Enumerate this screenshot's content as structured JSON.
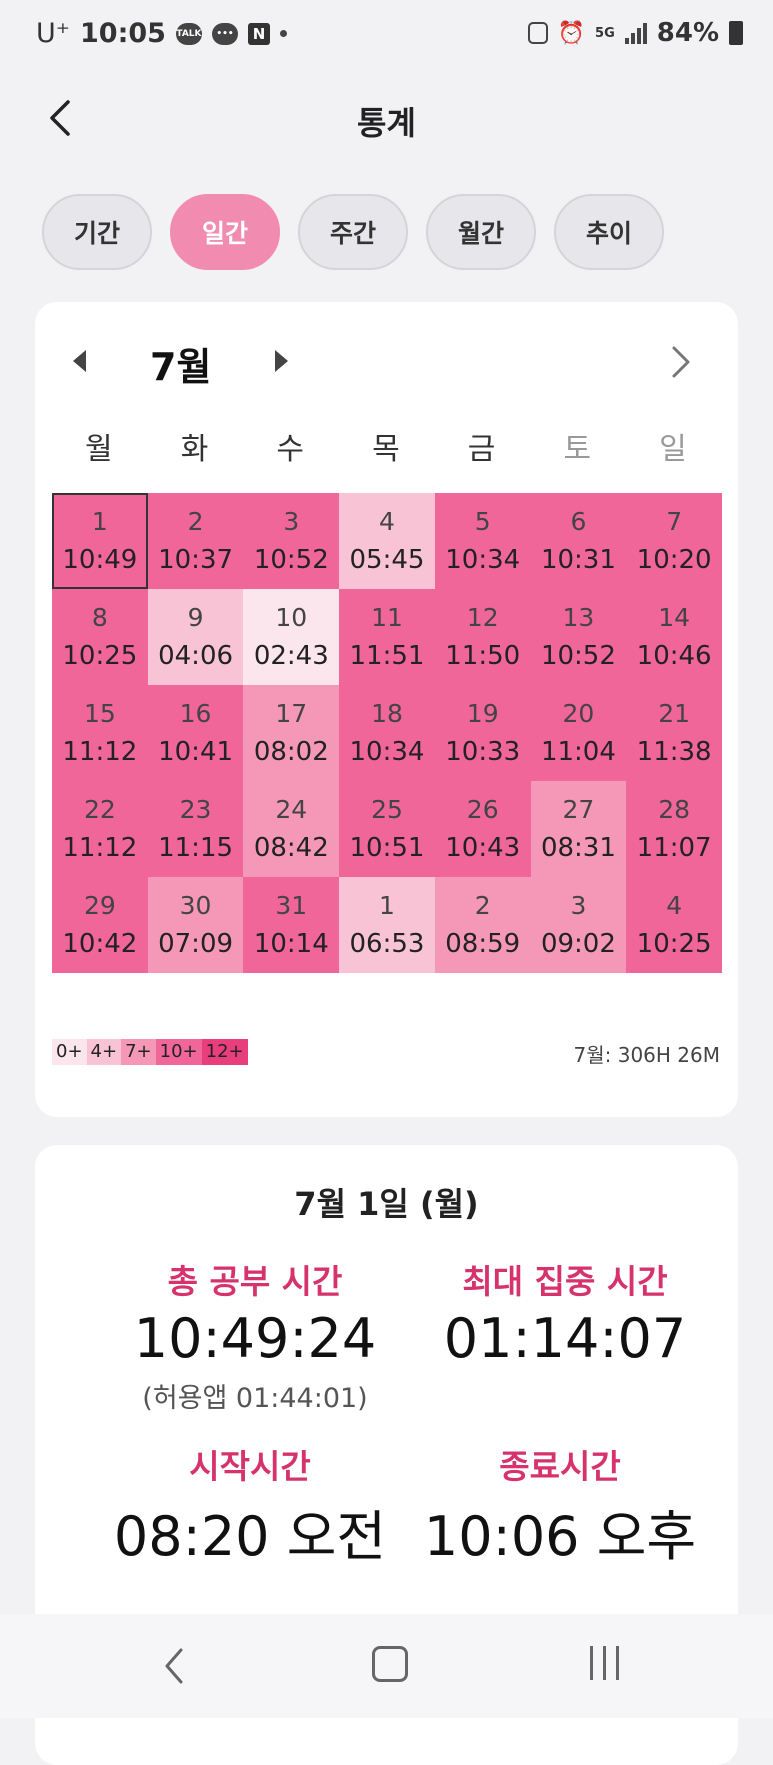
{
  "status_bar": {
    "carrier": "U⁺",
    "time": "10:05",
    "talk_badge": "TALK",
    "n_badge": "N",
    "network": "5G",
    "battery": "84%"
  },
  "header": {
    "title": "통계"
  },
  "tabs": [
    {
      "label": "기간",
      "active": false
    },
    {
      "label": "일간",
      "active": true
    },
    {
      "label": "주간",
      "active": false
    },
    {
      "label": "월간",
      "active": false
    },
    {
      "label": "추이",
      "active": false
    }
  ],
  "calendar": {
    "month": "7월",
    "weekdays": [
      "월",
      "화",
      "수",
      "목",
      "금",
      "토",
      "일"
    ],
    "level_colors": [
      "#fce6ed",
      "#f8c3d4",
      "#f598b8",
      "#f06699",
      "#e83e7c"
    ],
    "cells": [
      {
        "day": "1",
        "time": "10:49",
        "level": 3,
        "selected": true
      },
      {
        "day": "2",
        "time": "10:37",
        "level": 3
      },
      {
        "day": "3",
        "time": "10:52",
        "level": 3
      },
      {
        "day": "4",
        "time": "05:45",
        "level": 1
      },
      {
        "day": "5",
        "time": "10:34",
        "level": 3
      },
      {
        "day": "6",
        "time": "10:31",
        "level": 3
      },
      {
        "day": "7",
        "time": "10:20",
        "level": 3
      },
      {
        "day": "8",
        "time": "10:25",
        "level": 3
      },
      {
        "day": "9",
        "time": "04:06",
        "level": 1
      },
      {
        "day": "10",
        "time": "02:43",
        "level": 0
      },
      {
        "day": "11",
        "time": "11:51",
        "level": 3
      },
      {
        "day": "12",
        "time": "11:50",
        "level": 3
      },
      {
        "day": "13",
        "time": "10:52",
        "level": 3
      },
      {
        "day": "14",
        "time": "10:46",
        "level": 3
      },
      {
        "day": "15",
        "time": "11:12",
        "level": 3
      },
      {
        "day": "16",
        "time": "10:41",
        "level": 3
      },
      {
        "day": "17",
        "time": "08:02",
        "level": 2
      },
      {
        "day": "18",
        "time": "10:34",
        "level": 3
      },
      {
        "day": "19",
        "time": "10:33",
        "level": 3
      },
      {
        "day": "20",
        "time": "11:04",
        "level": 3
      },
      {
        "day": "21",
        "time": "11:38",
        "level": 3
      },
      {
        "day": "22",
        "time": "11:12",
        "level": 3
      },
      {
        "day": "23",
        "time": "11:15",
        "level": 3
      },
      {
        "day": "24",
        "time": "08:42",
        "level": 2
      },
      {
        "day": "25",
        "time": "10:51",
        "level": 3
      },
      {
        "day": "26",
        "time": "10:43",
        "level": 3
      },
      {
        "day": "27",
        "time": "08:31",
        "level": 2
      },
      {
        "day": "28",
        "time": "11:07",
        "level": 3
      },
      {
        "day": "29",
        "time": "10:42",
        "level": 3
      },
      {
        "day": "30",
        "time": "07:09",
        "level": 2
      },
      {
        "day": "31",
        "time": "10:14",
        "level": 3
      },
      {
        "day": "1",
        "time": "06:53",
        "level": 1
      },
      {
        "day": "2",
        "time": "08:59",
        "level": 2
      },
      {
        "day": "3",
        "time": "09:02",
        "level": 2
      },
      {
        "day": "4",
        "time": "10:25",
        "level": 3
      }
    ],
    "legend": [
      "0+",
      "4+",
      "7+",
      "10+",
      "12+"
    ],
    "total": "7월: 306H 26M"
  },
  "detail": {
    "date": "7월 1일 (월)",
    "total_label": "총 공부 시간",
    "total_value": "10:49:24",
    "allowed_apps": "(허용앱 01:44:01)",
    "max_focus_label": "최대 집중 시간",
    "max_focus_value": "01:14:07",
    "start_label": "시작시간",
    "start_value": "08:20 오전",
    "end_label": "종료시간",
    "end_value": "10:06 오후"
  }
}
